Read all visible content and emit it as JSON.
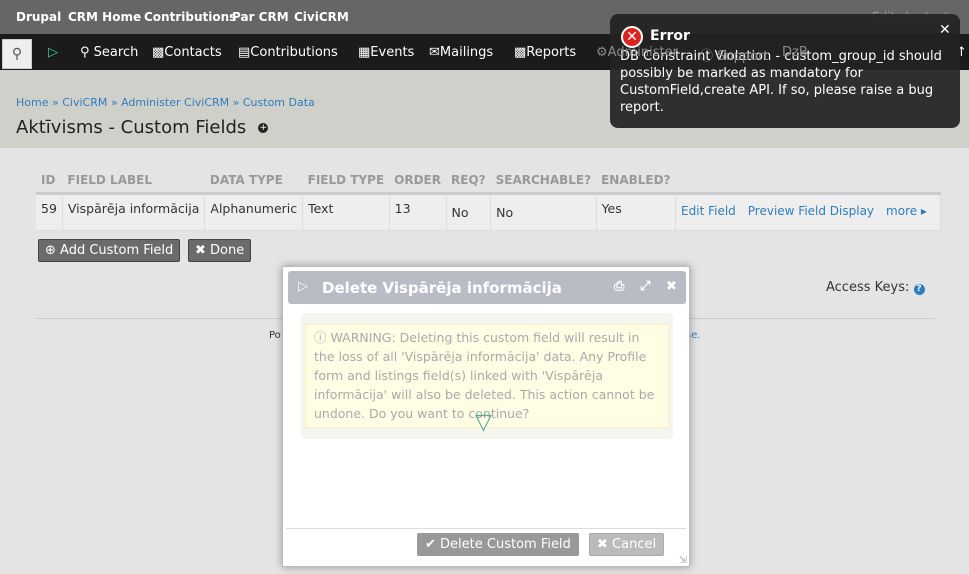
{
  "topbar": {
    "items": [
      "Drupal",
      "CRM Home",
      "Contributions",
      "Par CRM",
      "CiviCRM"
    ],
    "edit_shortcuts": "Edit shortcuts"
  },
  "nav": {
    "items": [
      "Search",
      "Contacts",
      "Contributions",
      "Events",
      "Mailings",
      "Reports",
      "Administer",
      "Support",
      "DzB"
    ]
  },
  "breadcrumb": [
    "Home",
    "CiviCRM",
    "Administer CiviCRM",
    "Custom Data"
  ],
  "page_title": "Aktīvisms - Custom Fields",
  "table": {
    "headers": [
      "ID",
      "FIELD LABEL",
      "DATA TYPE",
      "FIELD TYPE",
      "ORDER",
      "REQ?",
      "SEARCHABLE?",
      "ENABLED?",
      ""
    ],
    "rows": [
      {
        "id": "59",
        "label": "Vispārēja informācija",
        "data_type": "Alphanumeric",
        "field_type": "Text",
        "order": "13",
        "req": "No",
        "searchable": "No",
        "enabled": "Yes",
        "actions": [
          "Edit Field",
          "Preview Field Display",
          "more ▸"
        ]
      }
    ]
  },
  "buttons": {
    "add": "Add Custom Field",
    "done": "Done"
  },
  "access_keys": "Access Keys:",
  "footer": {
    "left": "Po",
    "right": "se."
  },
  "dialog": {
    "title": "Delete Vispārēja informācija",
    "warning": "WARNING: Deleting this custom field will result in the loss of all 'Vispārēja informācija' data. Any Profile form and listings field(s) linked with 'Vispārēja informācija' will also be deleted. This action cannot be undone. Do you want to continue?",
    "delete": "Delete Custom Field",
    "cancel": "Cancel"
  },
  "toast": {
    "title": "Error",
    "message": "DB Constraint Violation - custom_group_id should possibly be marked as mandatory for CustomField,create API. If so, please raise a bug report."
  }
}
